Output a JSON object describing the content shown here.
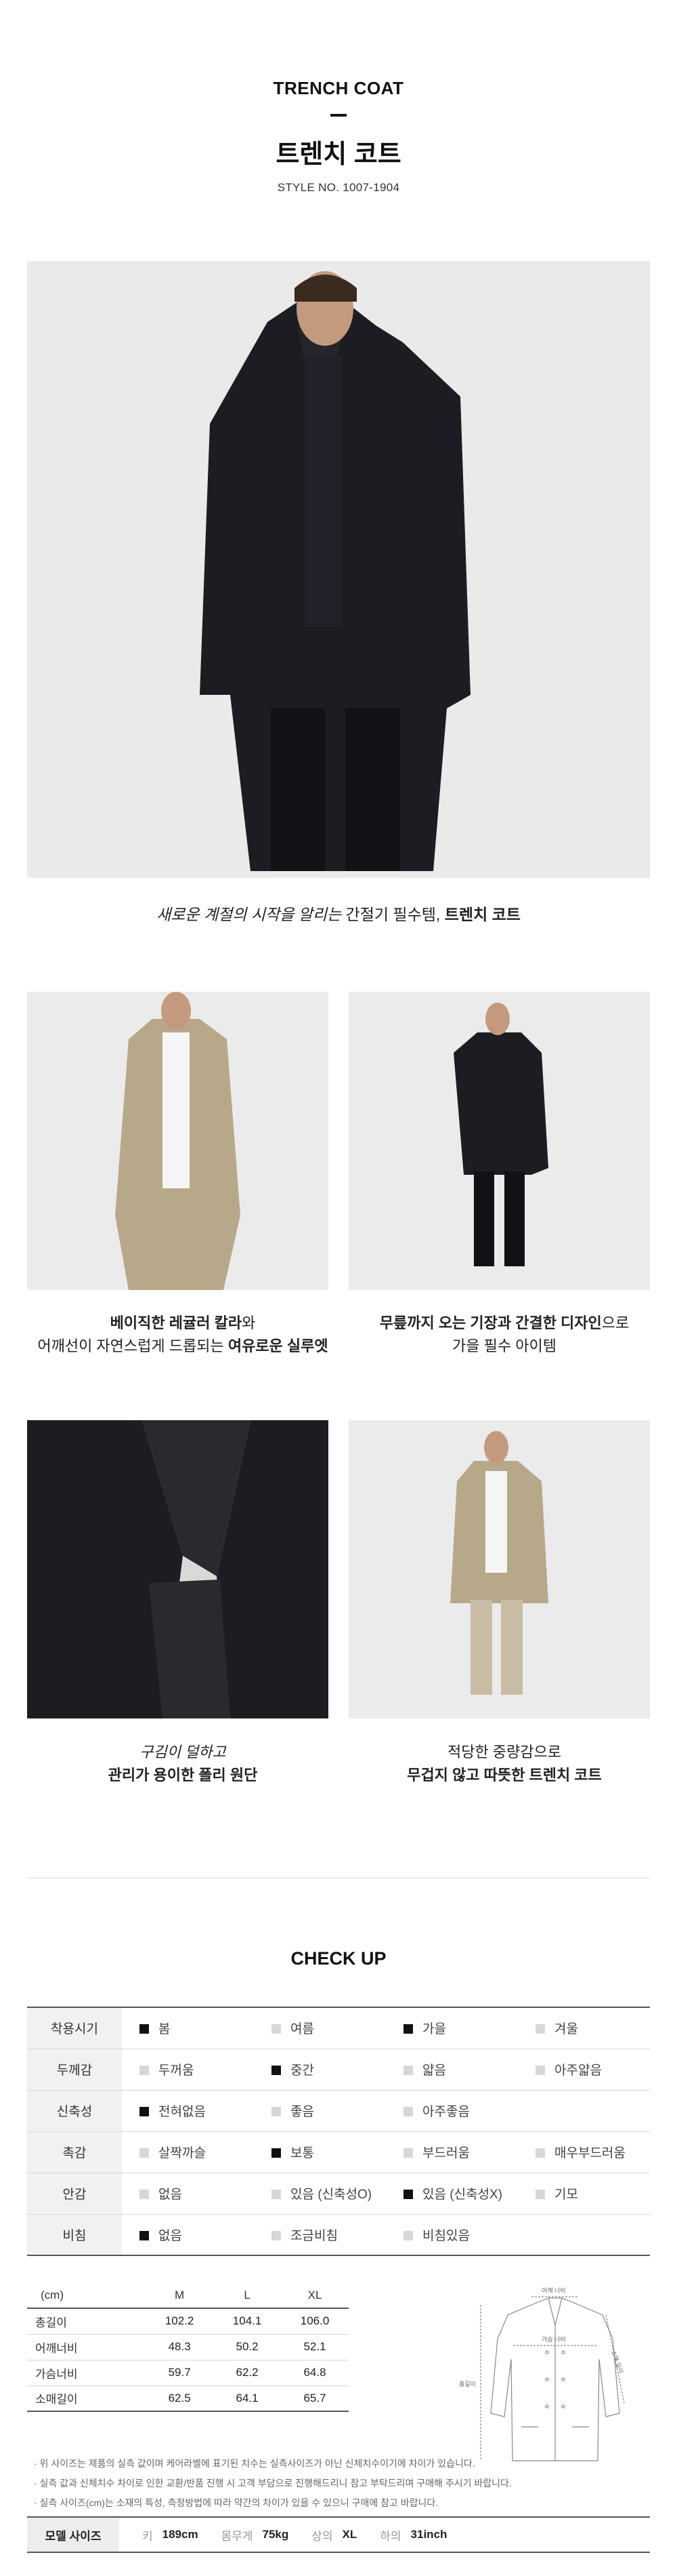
{
  "header": {
    "title_en": "TRENCH COAT",
    "title_ko": "트렌치 코트",
    "style_no": "STYLE NO. 1007-1904"
  },
  "main_caption": {
    "italic": "새로운 계절의 시작을 알리는",
    "normal": " 간절기 필수템, ",
    "bold": "트렌치 코트"
  },
  "details": [
    {
      "line1_bold_a": "베이직한 레귤러 칼라",
      "line1_normal": "와",
      "line2_normal": "어깨선이 자연스럽게 드롭되는 ",
      "line2_bold": "여유로운 실루엣"
    },
    {
      "line1_bold_a": "무릎까지 오는 기장과 간결한 디자인",
      "line1_normal": "으로",
      "line2_normal": "가을 필수 아이템",
      "line2_bold": ""
    },
    {
      "line1_italic": "구김이 덜하고",
      "line2_bold": "관리가 용이한 폴리 원단"
    },
    {
      "line1_normal": "적당한 중량감으로",
      "line2_bold": "무겁지 않고 따뜻한 트렌치 코트"
    }
  ],
  "checkup": {
    "title": "CHECK UP",
    "rows": [
      {
        "label": "착용시기",
        "options": [
          {
            "t": "봄",
            "on": true
          },
          {
            "t": "여름",
            "on": false
          },
          {
            "t": "가을",
            "on": true
          },
          {
            "t": "겨울",
            "on": false
          }
        ]
      },
      {
        "label": "두께감",
        "options": [
          {
            "t": "두꺼움",
            "on": false
          },
          {
            "t": "중간",
            "on": true
          },
          {
            "t": "얇음",
            "on": false
          },
          {
            "t": "아주얇음",
            "on": false
          }
        ]
      },
      {
        "label": "신축성",
        "options": [
          {
            "t": "전혀없음",
            "on": true
          },
          {
            "t": "좋음",
            "on": false
          },
          {
            "t": "아주좋음",
            "on": false
          }
        ]
      },
      {
        "label": "촉감",
        "options": [
          {
            "t": "살짝까슬",
            "on": false
          },
          {
            "t": "보통",
            "on": true
          },
          {
            "t": "부드러움",
            "on": false
          },
          {
            "t": "매우부드러움",
            "on": false
          }
        ]
      },
      {
        "label": "안감",
        "options": [
          {
            "t": "없음",
            "on": false
          },
          {
            "t": "있음 (신축성O)",
            "on": false
          },
          {
            "t": "있음 (신축성X)",
            "on": true
          },
          {
            "t": "기모",
            "on": false
          }
        ]
      },
      {
        "label": "비침",
        "options": [
          {
            "t": "없음",
            "on": true
          },
          {
            "t": "조금비침",
            "on": false
          },
          {
            "t": "비침있음",
            "on": false
          }
        ]
      }
    ]
  },
  "size_table": {
    "unit": "(cm)",
    "columns": [
      "M",
      "L",
      "XL"
    ],
    "rows": [
      {
        "label": "총길이",
        "values": [
          "102.2",
          "104.1",
          "106.0"
        ]
      },
      {
        "label": "어깨너비",
        "values": [
          "48.3",
          "50.2",
          "52.1"
        ]
      },
      {
        "label": "가슴너비",
        "values": [
          "59.7",
          "62.2",
          "64.8"
        ]
      },
      {
        "label": "소매길이",
        "values": [
          "62.5",
          "64.1",
          "65.7"
        ]
      }
    ]
  },
  "diagram_labels": {
    "shoulder": "어깨 너비",
    "chest": "가슴 너비",
    "length": "총길이",
    "sleeve": "소매 길이"
  },
  "notes": [
    "· 위 사이즈는 제품의 실측 값이며 케어라벨에 표기된 치수는 실측사이즈가 아닌 신체치수이기에 차이가 있습니다.",
    "· 실측 값과 신체치수 차이로 인한 교환/반품 진행 시 고객 부담으로 진행해드리니 참고 부탁드리며 구매해 주시기 바랍니다.",
    "· 실측 사이즈(cm)는 소재의 특성, 측정방법에 따라 약간의 차이가 있을 수 있으니 구매에 참고 바랍니다."
  ],
  "model": {
    "title": "모델 사이즈",
    "height_label": "키",
    "height": "189cm",
    "weight_label": "몸무게",
    "weight": "75kg",
    "top_label": "상의",
    "top": "XL",
    "bottom_label": "하의",
    "bottom": "31inch"
  },
  "colors": {
    "accent": "#111111",
    "photo_bg": "#ebebeb",
    "coat_black": "#1c1d22",
    "coat_beige": "#b8a88a"
  }
}
